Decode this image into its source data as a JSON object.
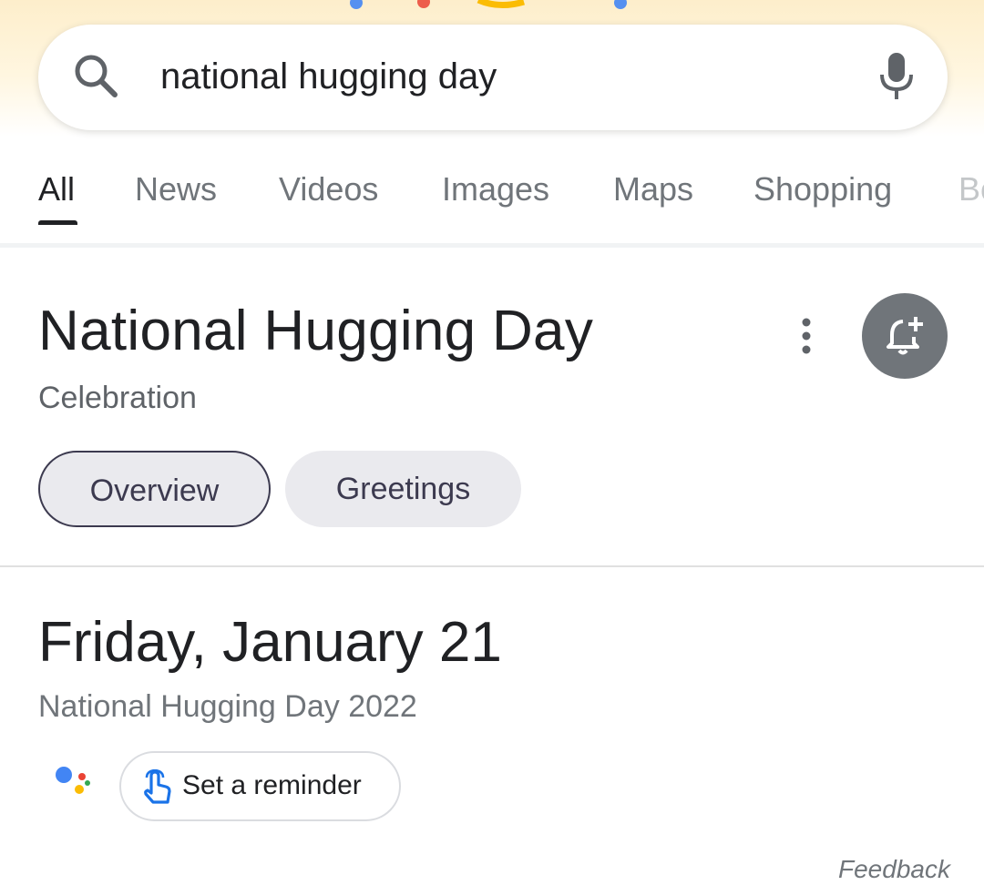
{
  "search": {
    "query": "national hugging day",
    "icon": "search-icon",
    "mic_icon": "mic-icon"
  },
  "tabs": [
    {
      "label": "All",
      "active": true
    },
    {
      "label": "News"
    },
    {
      "label": "Videos"
    },
    {
      "label": "Images"
    },
    {
      "label": "Maps"
    },
    {
      "label": "Shopping"
    },
    {
      "label": "Bo"
    }
  ],
  "knowledge_panel": {
    "title": "National Hugging Day",
    "subtitle": "Celebration",
    "more_icon": "more-vert-icon",
    "reminder_icon": "bell-add-icon",
    "chips": [
      {
        "label": "Overview",
        "selected": true
      },
      {
        "label": "Greetings"
      }
    ]
  },
  "date_card": {
    "date": "Friday, January 21",
    "caption": "National Hugging Day 2022",
    "assistant_icon": "google-assistant-icon",
    "reminder_button": {
      "label": "Set a reminder",
      "icon": "touch-hand-icon"
    }
  },
  "footer": {
    "feedback_label": "Feedback"
  },
  "colors": {
    "accent_blue": "#4285f4",
    "red": "#ea4335",
    "yellow": "#fbbc04",
    "green": "#34a853",
    "chip_bg": "#eaeaee",
    "reminder_circle": "#70757a"
  }
}
